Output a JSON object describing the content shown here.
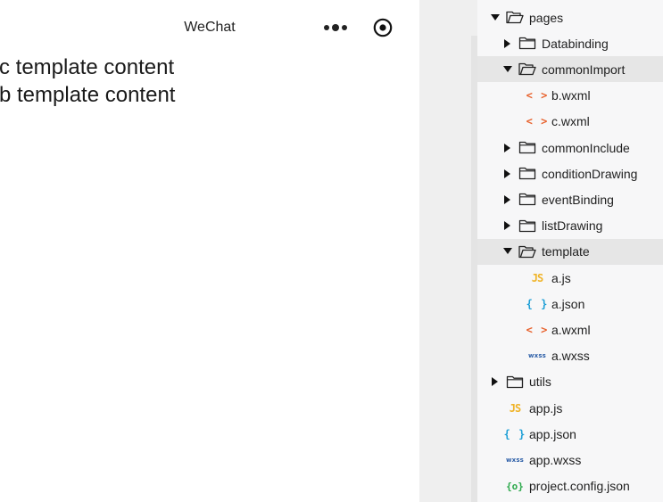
{
  "simulator": {
    "title": "WeChat",
    "content_lines": [
      "c template content",
      "b template content"
    ]
  },
  "file_tree": {
    "items": [
      {
        "label": "pages",
        "kind": "folder",
        "expanded": true,
        "depth": 0
      },
      {
        "label": "Databinding",
        "kind": "folder",
        "expanded": false,
        "depth": 1
      },
      {
        "label": "commonImport",
        "kind": "folder",
        "expanded": true,
        "depth": 1,
        "selected": true
      },
      {
        "label": "b.wxml",
        "kind": "wxml",
        "depth": 2,
        "icon_text": "< >"
      },
      {
        "label": "c.wxml",
        "kind": "wxml",
        "depth": 2,
        "icon_text": "< >"
      },
      {
        "label": "commonInclude",
        "kind": "folder",
        "expanded": false,
        "depth": 1
      },
      {
        "label": "conditionDrawing",
        "kind": "folder",
        "expanded": false,
        "depth": 1
      },
      {
        "label": "eventBinding",
        "kind": "folder",
        "expanded": false,
        "depth": 1
      },
      {
        "label": "listDrawing",
        "kind": "folder",
        "expanded": false,
        "depth": 1
      },
      {
        "label": "template",
        "kind": "folder",
        "expanded": true,
        "depth": 1,
        "selected": true
      },
      {
        "label": "a.js",
        "kind": "js",
        "depth": 2,
        "icon_text": "JS"
      },
      {
        "label": "a.json",
        "kind": "json",
        "depth": 2,
        "icon_text": "{ }"
      },
      {
        "label": "a.wxml",
        "kind": "wxml",
        "depth": 2,
        "icon_text": "< >"
      },
      {
        "label": "a.wxss",
        "kind": "wxss",
        "depth": 2,
        "icon_text": "wxss"
      },
      {
        "label": "utils",
        "kind": "folder",
        "expanded": false,
        "depth": 0
      },
      {
        "label": "app.js",
        "kind": "js",
        "depth": 0,
        "icon_text": "JS"
      },
      {
        "label": "app.json",
        "kind": "json",
        "depth": 0,
        "icon_text": "{ }"
      },
      {
        "label": "app.wxss",
        "kind": "wxss",
        "depth": 0,
        "icon_text": "wxss"
      },
      {
        "label": "project.config.json",
        "kind": "config",
        "depth": 0,
        "icon_text": "{o}"
      }
    ]
  },
  "colors": {
    "js": "#f0b429",
    "json": "#1e9fd6",
    "wxml": "#e8612c",
    "wxss": "#2d5fa8",
    "config": "#2aa84a",
    "selected_row": "#e6e6e6"
  }
}
